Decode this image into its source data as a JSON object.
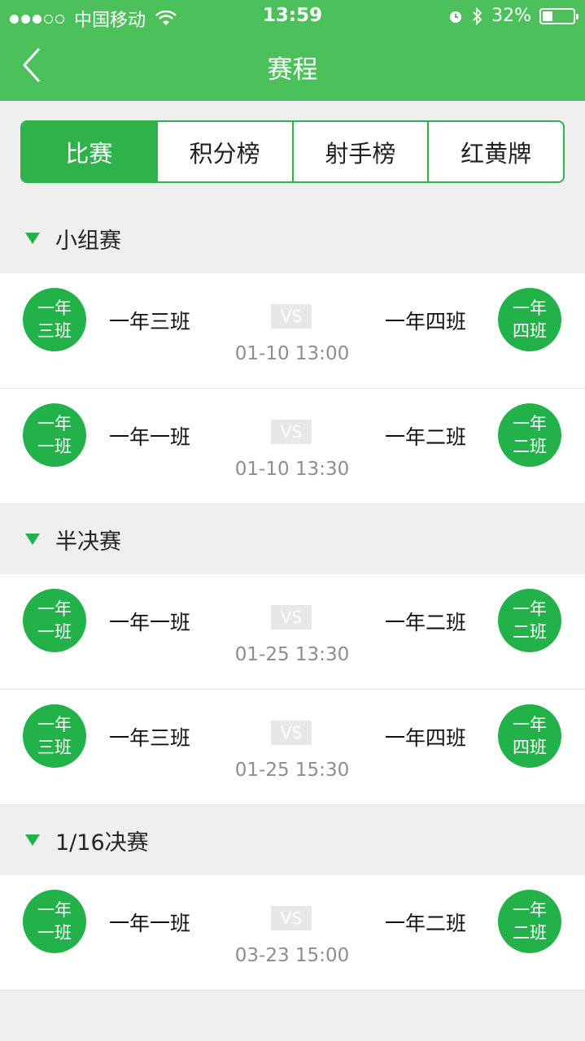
{
  "status": {
    "carrier": "中国移动",
    "time": "13:59",
    "battery": "32%",
    "battery_level": 0.32
  },
  "nav": {
    "title": "赛程"
  },
  "tabs": [
    "比赛",
    "积分榜",
    "射手榜",
    "红黄牌"
  ],
  "active_tab": 0,
  "colors": {
    "accent": "#4cc15b",
    "badge": "#23b14a"
  },
  "sections": [
    {
      "title": "小组赛",
      "matches": [
        {
          "home_badge": [
            "一年",
            "三班"
          ],
          "home": "一年三班",
          "vs": "VS",
          "time": "01-10 13:00",
          "away": "一年四班",
          "away_badge": [
            "一年",
            "四班"
          ]
        },
        {
          "home_badge": [
            "一年",
            "一班"
          ],
          "home": "一年一班",
          "vs": "VS",
          "time": "01-10 13:30",
          "away": "一年二班",
          "away_badge": [
            "一年",
            "二班"
          ]
        }
      ]
    },
    {
      "title": "半决赛",
      "matches": [
        {
          "home_badge": [
            "一年",
            "一班"
          ],
          "home": "一年一班",
          "vs": "VS",
          "time": "01-25 13:30",
          "away": "一年二班",
          "away_badge": [
            "一年",
            "二班"
          ]
        },
        {
          "home_badge": [
            "一年",
            "三班"
          ],
          "home": "一年三班",
          "vs": "VS",
          "time": "01-25 15:30",
          "away": "一年四班",
          "away_badge": [
            "一年",
            "四班"
          ]
        }
      ]
    },
    {
      "title": "1/16决赛",
      "matches": [
        {
          "home_badge": [
            "一年",
            "一班"
          ],
          "home": "一年一班",
          "vs": "VS",
          "time": "03-23 15:00",
          "away": "一年二班",
          "away_badge": [
            "一年",
            "二班"
          ]
        }
      ]
    }
  ]
}
